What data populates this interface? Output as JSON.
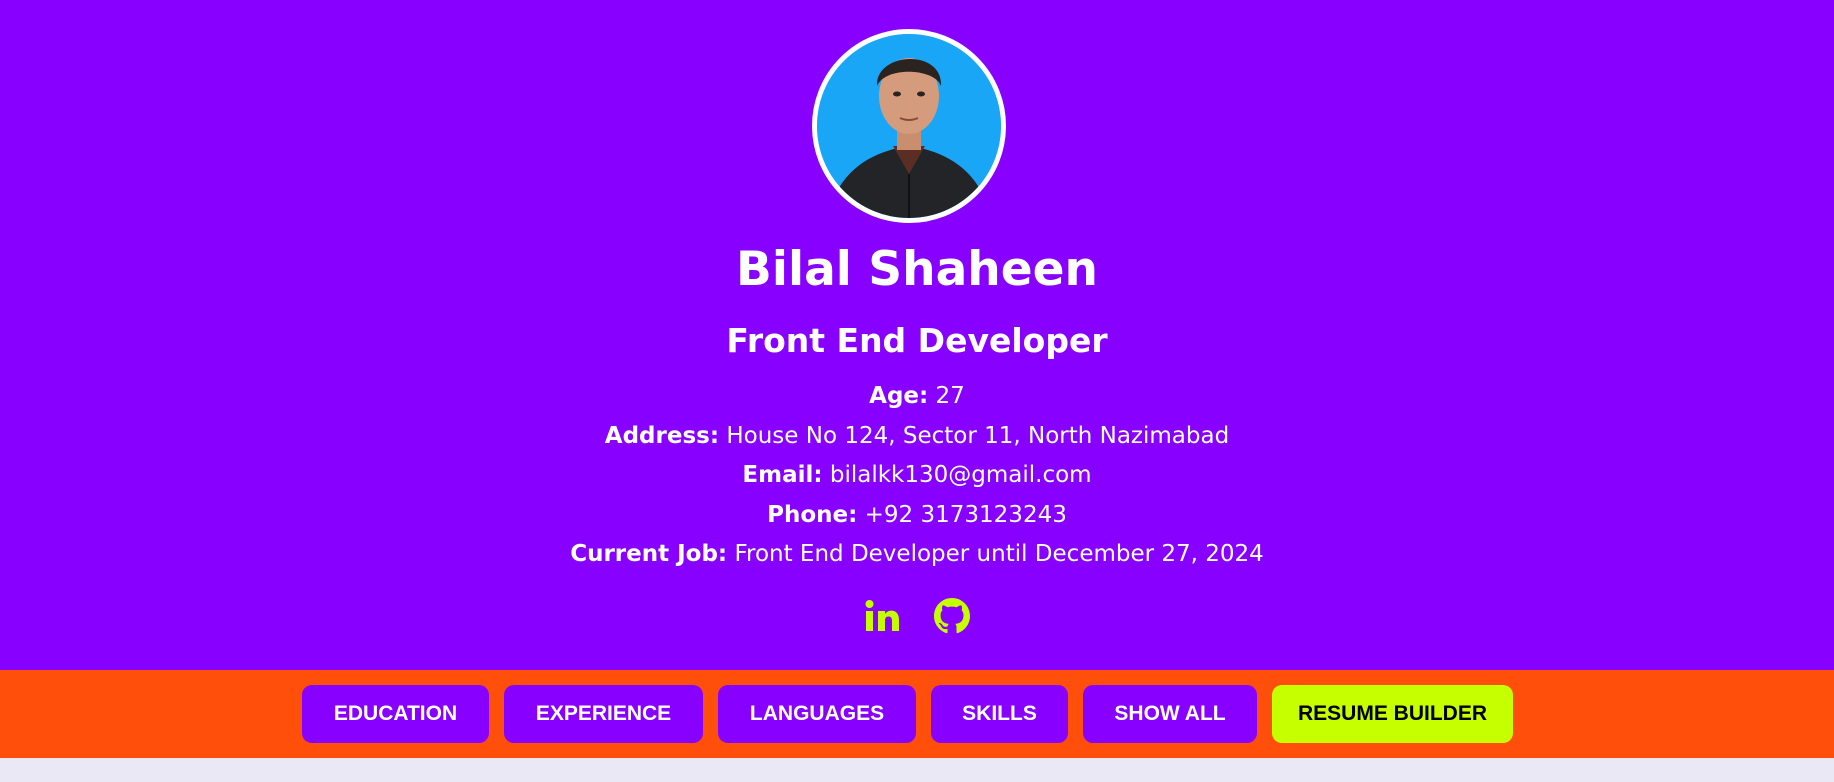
{
  "profile": {
    "name": "Bilal Shaheen",
    "title": "Front End Developer",
    "photo_alt": "profile-photo"
  },
  "info": [
    {
      "label": "Age:",
      "value": "27"
    },
    {
      "label": "Address:",
      "value": "House No 124, Sector 11, North Nazimabad"
    },
    {
      "label": "Email:",
      "value": "bilalkk130@gmail.com"
    },
    {
      "label": "Phone:",
      "value": "+92 3173123243"
    },
    {
      "label": "Current Job:",
      "value": "Front End Developer until December 27, 2024"
    }
  ],
  "socials": [
    {
      "icon": "linkedin-icon"
    },
    {
      "icon": "github-icon"
    }
  ],
  "nav": {
    "buttons": [
      {
        "label": "EDUCATION"
      },
      {
        "label": "EXPERIENCE"
      },
      {
        "label": "LANGUAGES"
      },
      {
        "label": "SKILLS"
      },
      {
        "label": "SHOW ALL"
      },
      {
        "label": "RESUME BUILDER"
      }
    ]
  },
  "colors": {
    "header_bg": "#8800ff",
    "nav_bg": "#ff4f0a",
    "accent": "#c6ff00",
    "button_bg": "#8800ff"
  }
}
